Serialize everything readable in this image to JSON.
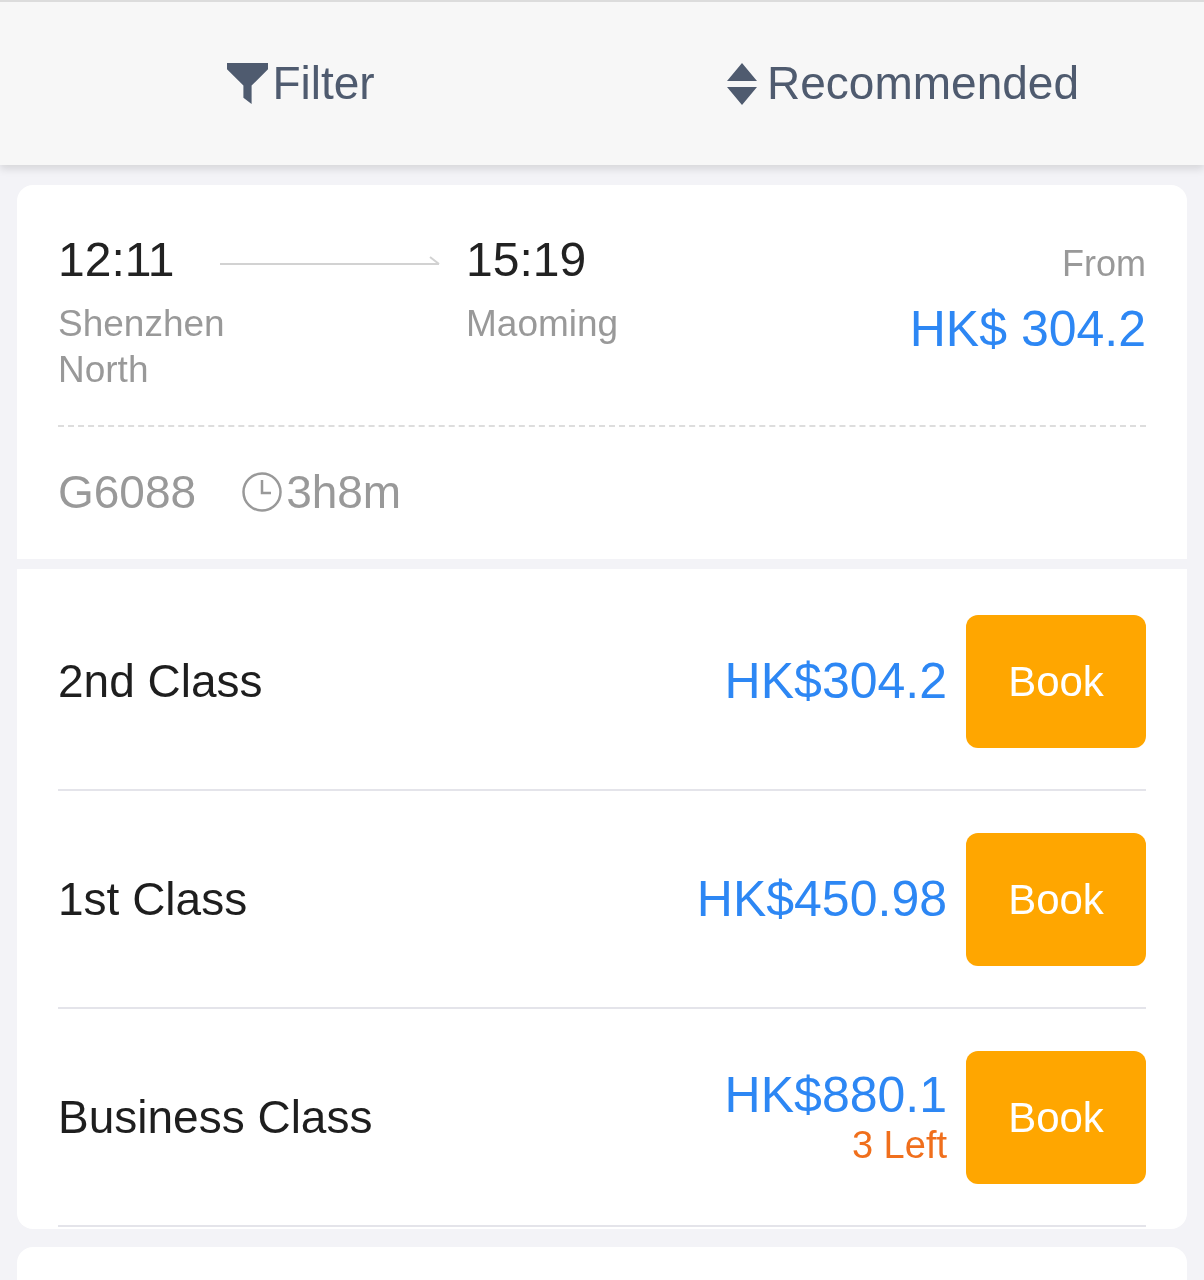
{
  "toolbar": {
    "filter": {
      "label": "Filter"
    },
    "sort": {
      "label": "Recommended"
    }
  },
  "trains": [
    {
      "departure": {
        "time": "12:11",
        "station": "Shenzhen North"
      },
      "arrival": {
        "time": "15:19",
        "station": "Maoming"
      },
      "price_label": "From",
      "price": "HK$ 304.2",
      "number": "G6088",
      "duration": "3h8m",
      "classes": [
        {
          "name": "2nd Class",
          "price": "HK$304.2",
          "button": "Book"
        },
        {
          "name": "1st Class",
          "price": "HK$450.98",
          "button": "Book"
        },
        {
          "name": "Business Class",
          "price": "HK$880.1",
          "availability": "3 Left",
          "button": "Book"
        }
      ]
    }
  ]
}
